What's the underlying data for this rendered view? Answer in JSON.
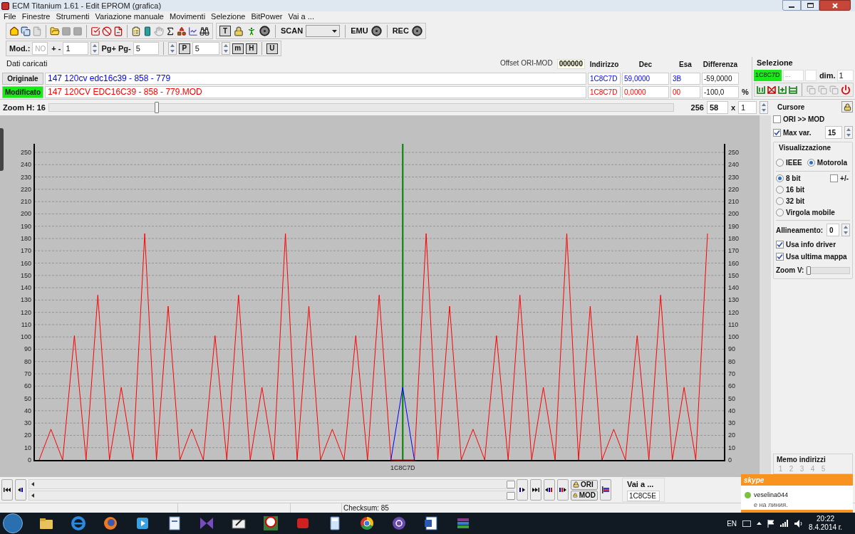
{
  "window": {
    "title": "ECM Titanium 1.61 - Edit EPROM (grafica)"
  },
  "menu": [
    "File",
    "Finestre",
    "Strumenti",
    "Variazione manuale",
    "Movimenti",
    "Selezione",
    "BitPower",
    "Vai a ..."
  ],
  "toolbar": {
    "scan_label": "SCAN",
    "emu_label": "EMU",
    "rec_label": "REC",
    "t_key": "T"
  },
  "toolbar2": {
    "mod_label": "Mod.:",
    "mod_value": "NO",
    "step_label": "+ -",
    "step_value": "1",
    "page_label": "Pg+ Pg-",
    "page_value": "5",
    "p_key": "P",
    "p_value": "5",
    "m_key": "m",
    "h_key": "H",
    "u_key": "U"
  },
  "loaded_data": {
    "title": "Dati caricati",
    "offset_label": "Offset ORI-MOD",
    "offset_value": "000000",
    "columns": [
      "Indirizzo",
      "Dec",
      "Esa",
      "Differenza"
    ],
    "rows": [
      {
        "label": "Originale",
        "selected": false,
        "color": "#0000ff",
        "file": "147  120cv edc16c39 - 858 - 779",
        "address": "1C8C7D",
        "dec": "59,0000",
        "hex": "3B",
        "difference": "-59,0000"
      },
      {
        "label": "Modificato",
        "selected": true,
        "color": "#ff0000",
        "file": "147  120CV EDC16C39 - 858 - 779.MOD",
        "address": "1C8C7D",
        "dec": "0,0000",
        "hex": "00",
        "difference": "-100,0",
        "unit": "%"
      }
    ]
  },
  "selection": {
    "title": "Selezione",
    "start": "1C8C7D",
    "end": "...",
    "dim_label": "dim.",
    "dim_value": "1"
  },
  "zoom_h": {
    "label": "Zoom H: 16",
    "level": 0.17,
    "max": "256",
    "value": "58",
    "times": "x",
    "multiplier": "1"
  },
  "chart": {
    "cursor": {
      "label": "1C8C7D",
      "level": 0.544
    },
    "right_axis_labels": [
      "250",
      "240",
      "230",
      "220",
      "210",
      "200",
      "190",
      "180",
      "170",
      "160",
      "150",
      "140",
      "130",
      "120",
      "110",
      "100",
      "90",
      "80",
      "70",
      "60",
      "50",
      "40",
      "30",
      "20",
      "10",
      "0"
    ],
    "chart_data": {
      "type": "line",
      "ylim": [
        0,
        250
      ],
      "grid": true,
      "yticks": [
        0,
        10,
        20,
        30,
        40,
        50,
        60,
        70,
        80,
        90,
        100,
        110,
        120,
        130,
        140,
        150,
        160,
        170,
        180,
        190,
        200,
        210,
        220,
        230,
        240,
        250
      ],
      "series": [
        {
          "color": "#ff0000",
          "values": [
            0,
            25,
            0,
            101,
            0,
            134,
            0,
            59,
            0,
            184,
            0,
            125,
            0,
            25,
            0,
            101,
            0,
            134,
            0,
            59,
            0,
            184,
            0,
            125,
            0,
            25,
            0,
            101,
            0,
            134,
            0,
            0,
            0,
            184,
            0,
            125,
            0,
            25,
            0,
            101,
            0,
            134,
            0,
            59,
            0,
            184,
            0,
            125,
            0,
            25,
            0,
            101,
            0,
            134,
            0,
            59,
            0,
            184
          ]
        },
        {
          "color": "#0000ff",
          "values": [
            null,
            null,
            null,
            null,
            null,
            null,
            null,
            null,
            null,
            null,
            null,
            null,
            null,
            null,
            null,
            null,
            null,
            null,
            null,
            null,
            null,
            null,
            null,
            null,
            null,
            null,
            null,
            null,
            null,
            null,
            0,
            59,
            0,
            null,
            null,
            null,
            null,
            null,
            null,
            null,
            null,
            null,
            null,
            null,
            null,
            null,
            null,
            null,
            null,
            null,
            null,
            null,
            null,
            null,
            null,
            null,
            null,
            null
          ]
        }
      ]
    }
  },
  "cursor": {
    "title": "Cursore",
    "ori_mod": {
      "label": "ORI >> MOD",
      "checked": false
    },
    "max_var": {
      "label": "Max var.",
      "checked": true,
      "value": "15"
    }
  },
  "display": {
    "title": "Visualizzazione",
    "byte_order": [
      {
        "label": "IEEE",
        "selected": false
      },
      {
        "label": "Motorola",
        "selected": true
      }
    ],
    "formats": [
      {
        "label": "8 bit",
        "selected": true
      },
      {
        "label": "16 bit",
        "selected": false
      },
      {
        "label": "32 bit",
        "selected": false
      },
      {
        "label": "Virgola mobile",
        "selected": false
      }
    ],
    "signed": {
      "label": "+/-",
      "checked": false
    },
    "alignment_label": "Allineamento:",
    "alignment_value": "0",
    "options": [
      {
        "label": "Usa info driver",
        "checked": true
      },
      {
        "label": "Usa ultima mappa",
        "checked": true
      }
    ],
    "zoom_v": {
      "label": "Zoom V:",
      "level": 0
    }
  },
  "memo": {
    "title": "Memo indirizzi",
    "slots": [
      "1",
      "2",
      "3",
      "4",
      "5"
    ]
  },
  "navigation": {
    "ori_label": "ORI",
    "mod_label": "MOD",
    "goto_title": "Vai a ...",
    "goto_value": "1C8C5E"
  },
  "status_bar": {
    "checksum": "Checksum: 85"
  },
  "notification": {
    "app": "skype",
    "user": "veselina044",
    "status": "е на линия."
  },
  "taskbar": {
    "language": "EN",
    "time": "20:22",
    "date": "8.4.2014 г."
  }
}
